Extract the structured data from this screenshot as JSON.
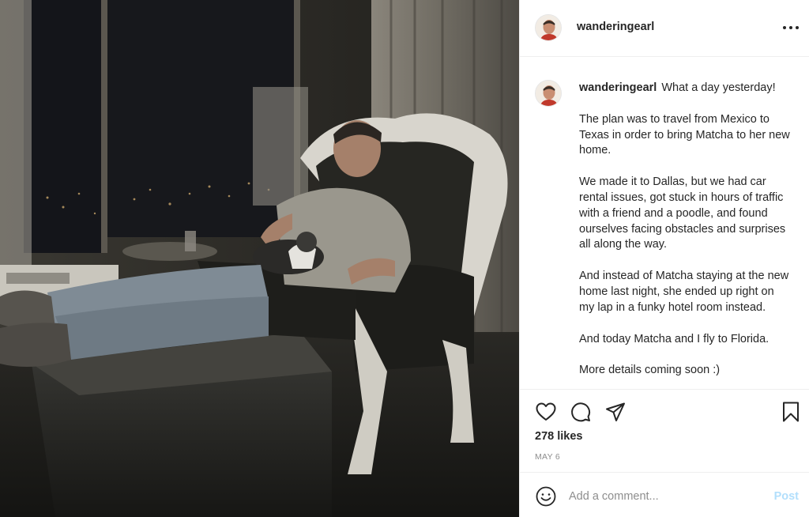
{
  "post": {
    "username": "wanderingearl",
    "image_alt": "Man relaxing in an armchair with a cat on his lap in a hotel room at night"
  },
  "caption": {
    "username": "wanderingearl",
    "paragraphs": [
      "What a day yesterday!",
      "The plan was to travel from Mexico to Texas in order to bring Matcha to her new home.",
      "We made it to Dallas, but we had car rental issues, got stuck in hours of traffic with a friend and a poodle, and found ourselves facing obstacles and surprises all along the way.",
      "And instead of Matcha staying at the new home last night, she ended up right on my lap in a funky hotel room instead.",
      "And today Matcha and I fly to Florida.",
      "More details coming soon :)"
    ]
  },
  "stats": {
    "likes": "278 likes",
    "date": "MAY 6"
  },
  "comment_box": {
    "placeholder": "Add a comment...",
    "post_label": "Post"
  },
  "icons": {
    "like": "heart-icon",
    "comment": "comment-bubble-icon",
    "share": "paper-plane-icon",
    "save": "bookmark-icon",
    "emoji": "smiley-icon",
    "more": "more-options-icon"
  },
  "colors": {
    "text": "#262626",
    "secondary": "#8e8e8e",
    "border": "#efefef",
    "post_disabled": "#b2dffc"
  }
}
